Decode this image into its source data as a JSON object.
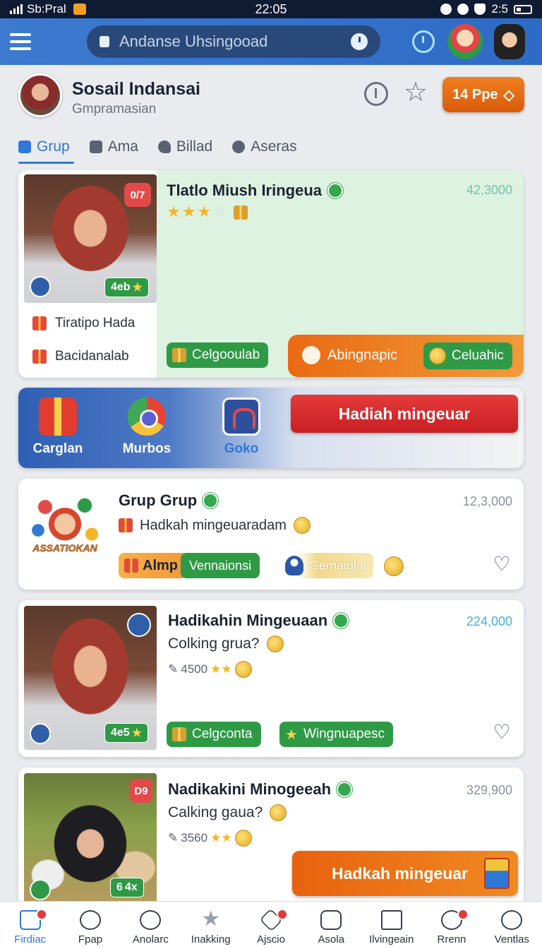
{
  "status_bar": {
    "carrier": "Sb:Pral",
    "time": "22:05",
    "right_text": "2:5"
  },
  "search": {
    "placeholder": "Andanse Uhsingooad"
  },
  "profile": {
    "name": "Sosail Indansai",
    "subtitle": "Gmpramasian",
    "pill_label": "14 Ppe"
  },
  "tabs": [
    {
      "label": "Grup",
      "active": true
    },
    {
      "label": "Ama"
    },
    {
      "label": "Billad"
    },
    {
      "label": "Aseras"
    }
  ],
  "card1": {
    "title": "Tlatlo Miush Iringeua",
    "count": "42,3000",
    "rating": 3,
    "photo_badge": "0/7",
    "photo_tag": "4eb",
    "list": [
      "Tiratipo Hada",
      "Bacidanalab"
    ],
    "chip": "Celgooulab",
    "banner_label": "Abingnapic",
    "banner_chip": "Celuahic"
  },
  "strip": {
    "items": [
      "Carglan",
      "Murbos",
      "Goko"
    ],
    "cta": "Hadiah mingeuar"
  },
  "card_group": {
    "logo_text": "ASSATIOKAN",
    "title": "Grup Grup",
    "count": "12,3,000",
    "line": "Hadkah mingeuaradam",
    "chip_a": "Almp",
    "chip_b": "Vennaionsi",
    "chip_c": "Gemaiglar"
  },
  "card4": {
    "title": "Hadikahin Mingeuaan",
    "count": "224,000",
    "line": "Colking grua?",
    "stat": "4500",
    "photo_tag": "4e5",
    "chip1": "Celgconta",
    "chip2": "Wingnuapesc"
  },
  "card5": {
    "title": "Nadikakini Minogeeah",
    "count": "329,900",
    "line": "Calking gaua?",
    "stat": "3560",
    "photo_badge": "D9",
    "photo_tag": "4x",
    "cta": "Hadkah mingeuar"
  },
  "bottom_nav": [
    {
      "label": "Firdiac",
      "active": true,
      "dot": true
    },
    {
      "label": "Fpap"
    },
    {
      "label": "Anolarc"
    },
    {
      "label": "Inakking"
    },
    {
      "label": "Ajscio",
      "dot": true
    },
    {
      "label": "Asola"
    },
    {
      "label": "Ilvingeain"
    },
    {
      "label": "Rrenn",
      "dot": true
    },
    {
      "label": "Ventlas"
    }
  ],
  "colors": {
    "accent": "#2f78d6",
    "primary_bar": "#3d7ad0",
    "success": "#2f9a46",
    "danger": "#e43a3a",
    "warning": "#ee7a1a"
  }
}
